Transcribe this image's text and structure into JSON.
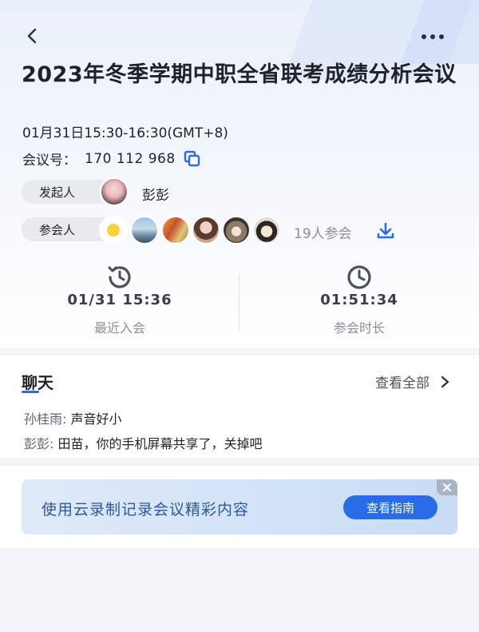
{
  "header": {
    "back_icon": "chevron-left-icon",
    "more_icon": "more-horizontal-icon"
  },
  "meeting": {
    "title": "2023年冬季学期中职全省联考成绩分析会议",
    "time": "01月31日15:30-16:30(GMT+8)",
    "id_label": "会议号：",
    "id_value": "170 112 968"
  },
  "host": {
    "label": "发起人",
    "name": "彭彭"
  },
  "attendees": {
    "label": "参会人",
    "count_text": "19人参会"
  },
  "stats": {
    "last_join": {
      "value": "01/31 15:36",
      "label": "最近入会"
    },
    "duration": {
      "value": "01:51:34",
      "label": "参会时长"
    }
  },
  "chat": {
    "title": "聊天",
    "view_all": "查看全部",
    "messages": [
      {
        "sender": "孙桂雨:",
        "text": "声音好小"
      },
      {
        "sender": "彭彭:",
        "text": "田苗，你的手机屏幕共享了，关掉吧"
      }
    ]
  },
  "banner": {
    "text": "使用云录制记录会议精彩内容",
    "button": "查看指南"
  },
  "colors": {
    "accent": "#2a6be8",
    "banner_text": "#2b5a9b"
  }
}
